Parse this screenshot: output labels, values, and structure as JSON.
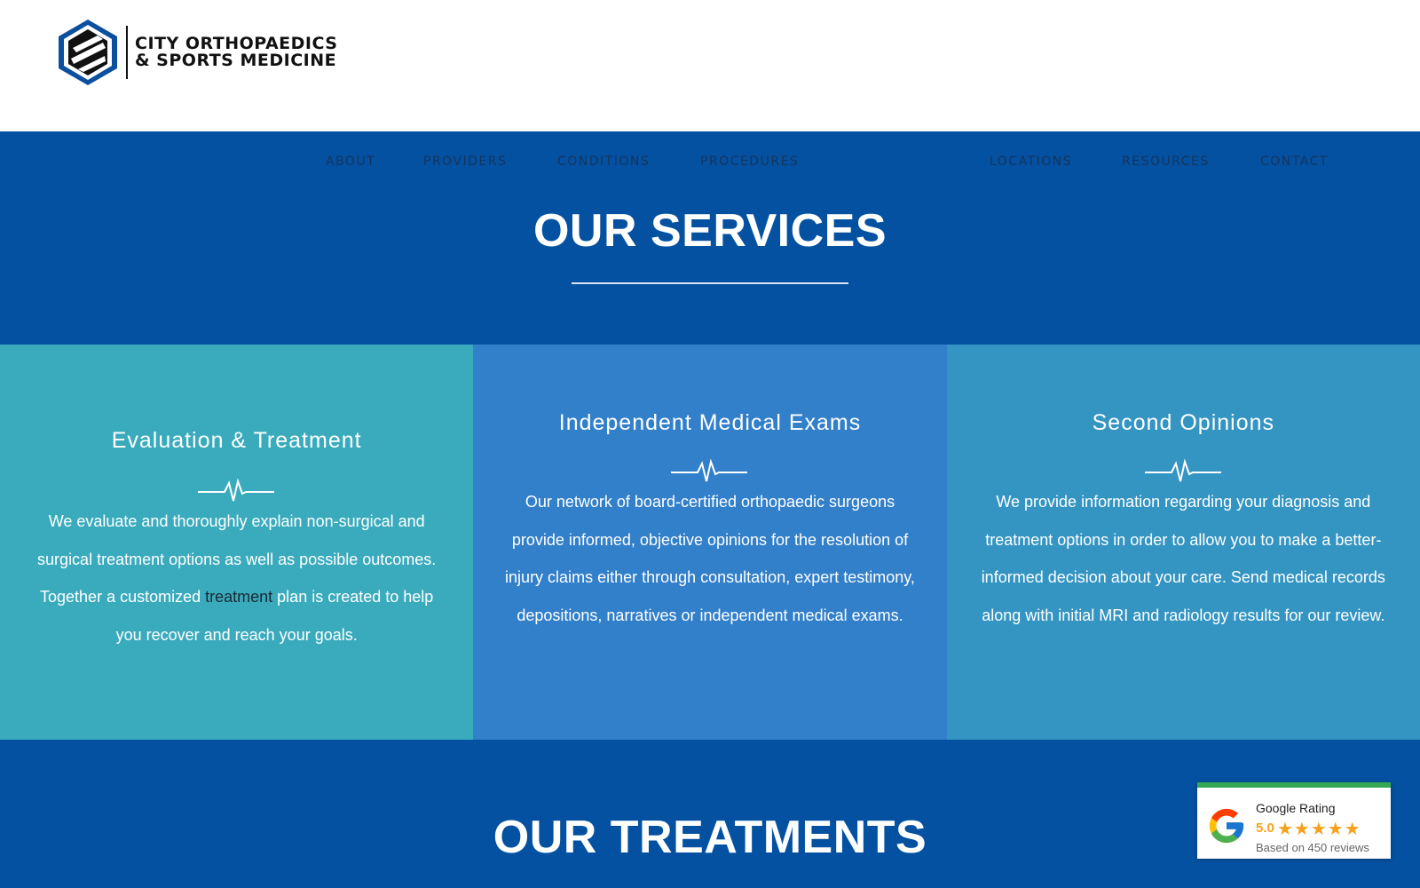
{
  "header": {
    "logo_line1": "CITY ORTHOPAEDICS",
    "logo_line2": "& SPORTS MEDICINE"
  },
  "nav": {
    "items": [
      "ABOUT",
      "PROVIDERS",
      "CONDITIONS",
      "PROCEDURES",
      "LOCATIONS",
      "RESOURCES",
      "CONTACT"
    ]
  },
  "services": {
    "title": "OUR SERVICES",
    "cards": [
      {
        "title": "Evaluation & Treatment",
        "text_before": "We evaluate and thoroughly explain non-surgical and surgical treatment options as well as possible outcomes. Together a customized ",
        "text_highlight": "treatment",
        "text_after": " plan is created to help you recover and reach your goals."
      },
      {
        "title": "Independent Medical Exams",
        "text": "Our network of board-certified orthopaedic surgeons provide informed, objective opinions for the resolution of injury claims either through consultation, expert testimony, depositions, narratives or independent medical exams."
      },
      {
        "title": "Second Opinions",
        "text": "We provide information regarding your diagnosis and treatment options in order to allow you to make a better-informed decision about your care. Send medical records along with initial MRI and radiology results for our review."
      }
    ]
  },
  "treatments": {
    "title": "OUR TREATMENTS"
  },
  "google_rating": {
    "label": "Google Rating",
    "score": "5.0",
    "stars": "★★★★★",
    "reviews": "Based on 450 reviews",
    "star_count": 5
  },
  "colors": {
    "brand_blue": "#0451a1",
    "card_teal": "#3aabbd",
    "card_blue": "#327fca",
    "card_sky": "#3495c2",
    "star_orange": "#f6a21c"
  }
}
